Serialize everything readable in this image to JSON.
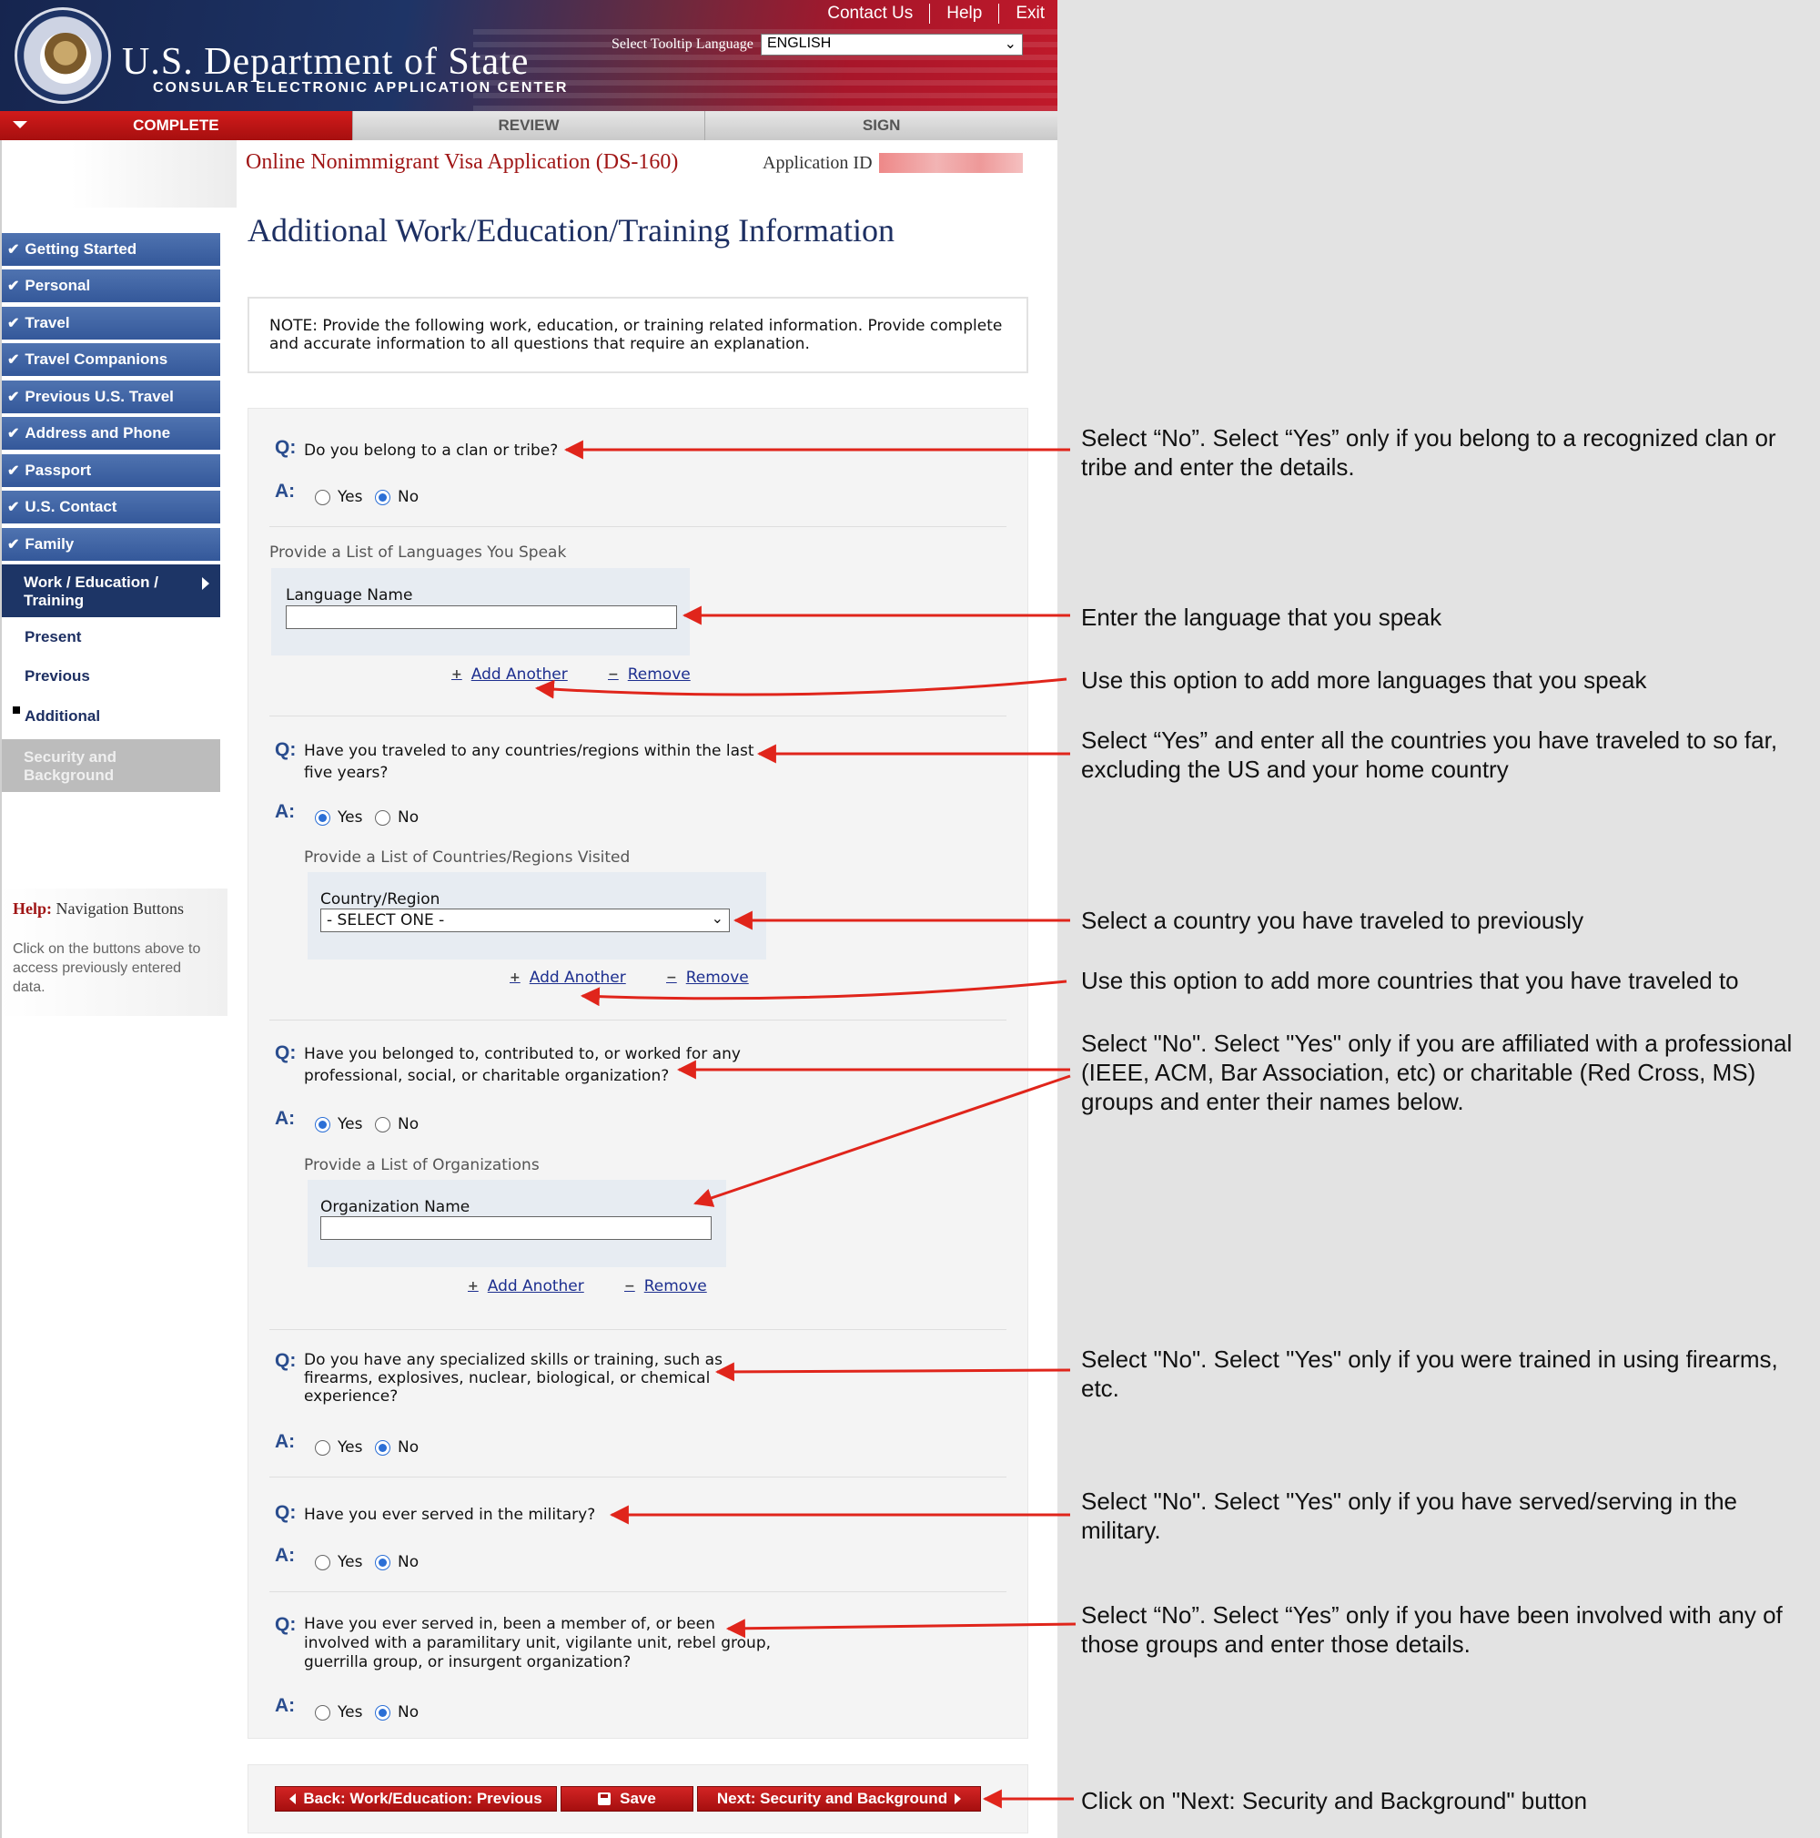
{
  "header": {
    "title": "U.S. Department of State",
    "subtitle": "CONSULAR ELECTRONIC APPLICATION CENTER",
    "links": [
      "Contact Us",
      "Help",
      "Exit"
    ],
    "tooltip_label": "Select Tooltip Language",
    "tooltip_value": "ENGLISH"
  },
  "tabs": [
    {
      "label": "COMPLETE",
      "active": true
    },
    {
      "label": "REVIEW",
      "active": false
    },
    {
      "label": "SIGN",
      "active": false
    }
  ],
  "app": {
    "title": "Online Nonimmigrant Visa Application (DS-160)",
    "id_label": "Application ID"
  },
  "page_title": "Additional Work/Education/Training Information",
  "sidebar": {
    "items": [
      {
        "label": "Getting Started"
      },
      {
        "label": "Personal"
      },
      {
        "label": "Travel"
      },
      {
        "label": "Travel Companions"
      },
      {
        "label": "Previous U.S. Travel"
      },
      {
        "label": "Address and Phone"
      },
      {
        "label": "Passport"
      },
      {
        "label": "U.S. Contact"
      },
      {
        "label": "Family"
      }
    ],
    "current_line1": "Work / Education /",
    "current_line2": "Training",
    "sub": [
      "Present",
      "Previous",
      "Additional"
    ],
    "next_line1": "Security and",
    "next_line2": "Background",
    "help_title_bold": "Help:",
    "help_title_rest": "Navigation Buttons",
    "help_text": "Click on the buttons above to access previously entered data."
  },
  "note": "NOTE: Provide the following work, education, or training related information. Provide complete and accurate information to all questions that require an explanation.",
  "labels": {
    "q": "Q:",
    "a": "A:",
    "yes": "Yes",
    "no": "No",
    "add": "Add Another",
    "remove": "Remove"
  },
  "questions": {
    "clan": {
      "text": "Do you belong to a clan or tribe?",
      "answer": "No"
    },
    "languages": {
      "heading": "Provide a List of Languages You Speak",
      "field_label": "Language Name",
      "value": ""
    },
    "traveled": {
      "line1": "Have you traveled to any countries/regions within the last",
      "line2": "five years?",
      "answer": "Yes"
    },
    "countries": {
      "heading": "Provide a List of Countries/Regions Visited",
      "field_label": "Country/Region",
      "value": "- SELECT ONE -"
    },
    "org": {
      "line1": "Have you belonged to, contributed to, or worked for any",
      "line2": "professional, social, or charitable organization?",
      "answer": "Yes"
    },
    "orgs": {
      "heading": "Provide a List of Organizations",
      "field_label": "Organization Name",
      "value": ""
    },
    "skills": {
      "line1": "Do you have any specialized skills or training, such as",
      "line2": "firearms, explosives, nuclear, biological, or chemical",
      "line3": "experience?",
      "answer": "No"
    },
    "military": {
      "text": "Have you ever served in the military?",
      "answer": "No"
    },
    "paramilitary": {
      "line1": "Have you ever served in, been a member of, or been",
      "line2": "involved with a paramilitary unit, vigilante unit, rebel group,",
      "line3": "guerrilla group, or insurgent organization?",
      "answer": "No"
    }
  },
  "buttons": {
    "back": "Back: Work/Education: Previous",
    "save": "Save",
    "next": "Next: Security and Background"
  },
  "annotations": {
    "clan": "Select “No”. Select “Yes” only if you belong to a recognized clan or tribe and enter the details.",
    "language": "Enter the language that you speak",
    "add_language": "Use this option to add more languages that you speak",
    "traveled": "Select “Yes” and enter all the countries you have traveled to so far, excluding the US and your home country",
    "country": "Select a country you have traveled to previously",
    "add_country": "Use this option to add more countries that you have traveled to",
    "org": "Select \"No\". Select \"Yes\" only if you are affiliated with a professional (IEEE, ACM, Bar Association, etc) or charitable (Red Cross, MS) groups and enter their names below.",
    "skills": "Select \"No\". Select \"Yes\" only if you were trained in using firearms, etc.",
    "military": "Select \"No\". Select \"Yes\" only if you have served/serving in the military.",
    "paramilitary": "Select “No”. Select “Yes” only if you have been involved with any of those groups and enter those details.",
    "next": "Click on \"Next: Security and Background\" button"
  },
  "colors": {
    "nav_blue": "#34589a",
    "accent_red": "#c0192a",
    "arrow_red": "#e0251b",
    "title_navy": "#1d2f62"
  }
}
